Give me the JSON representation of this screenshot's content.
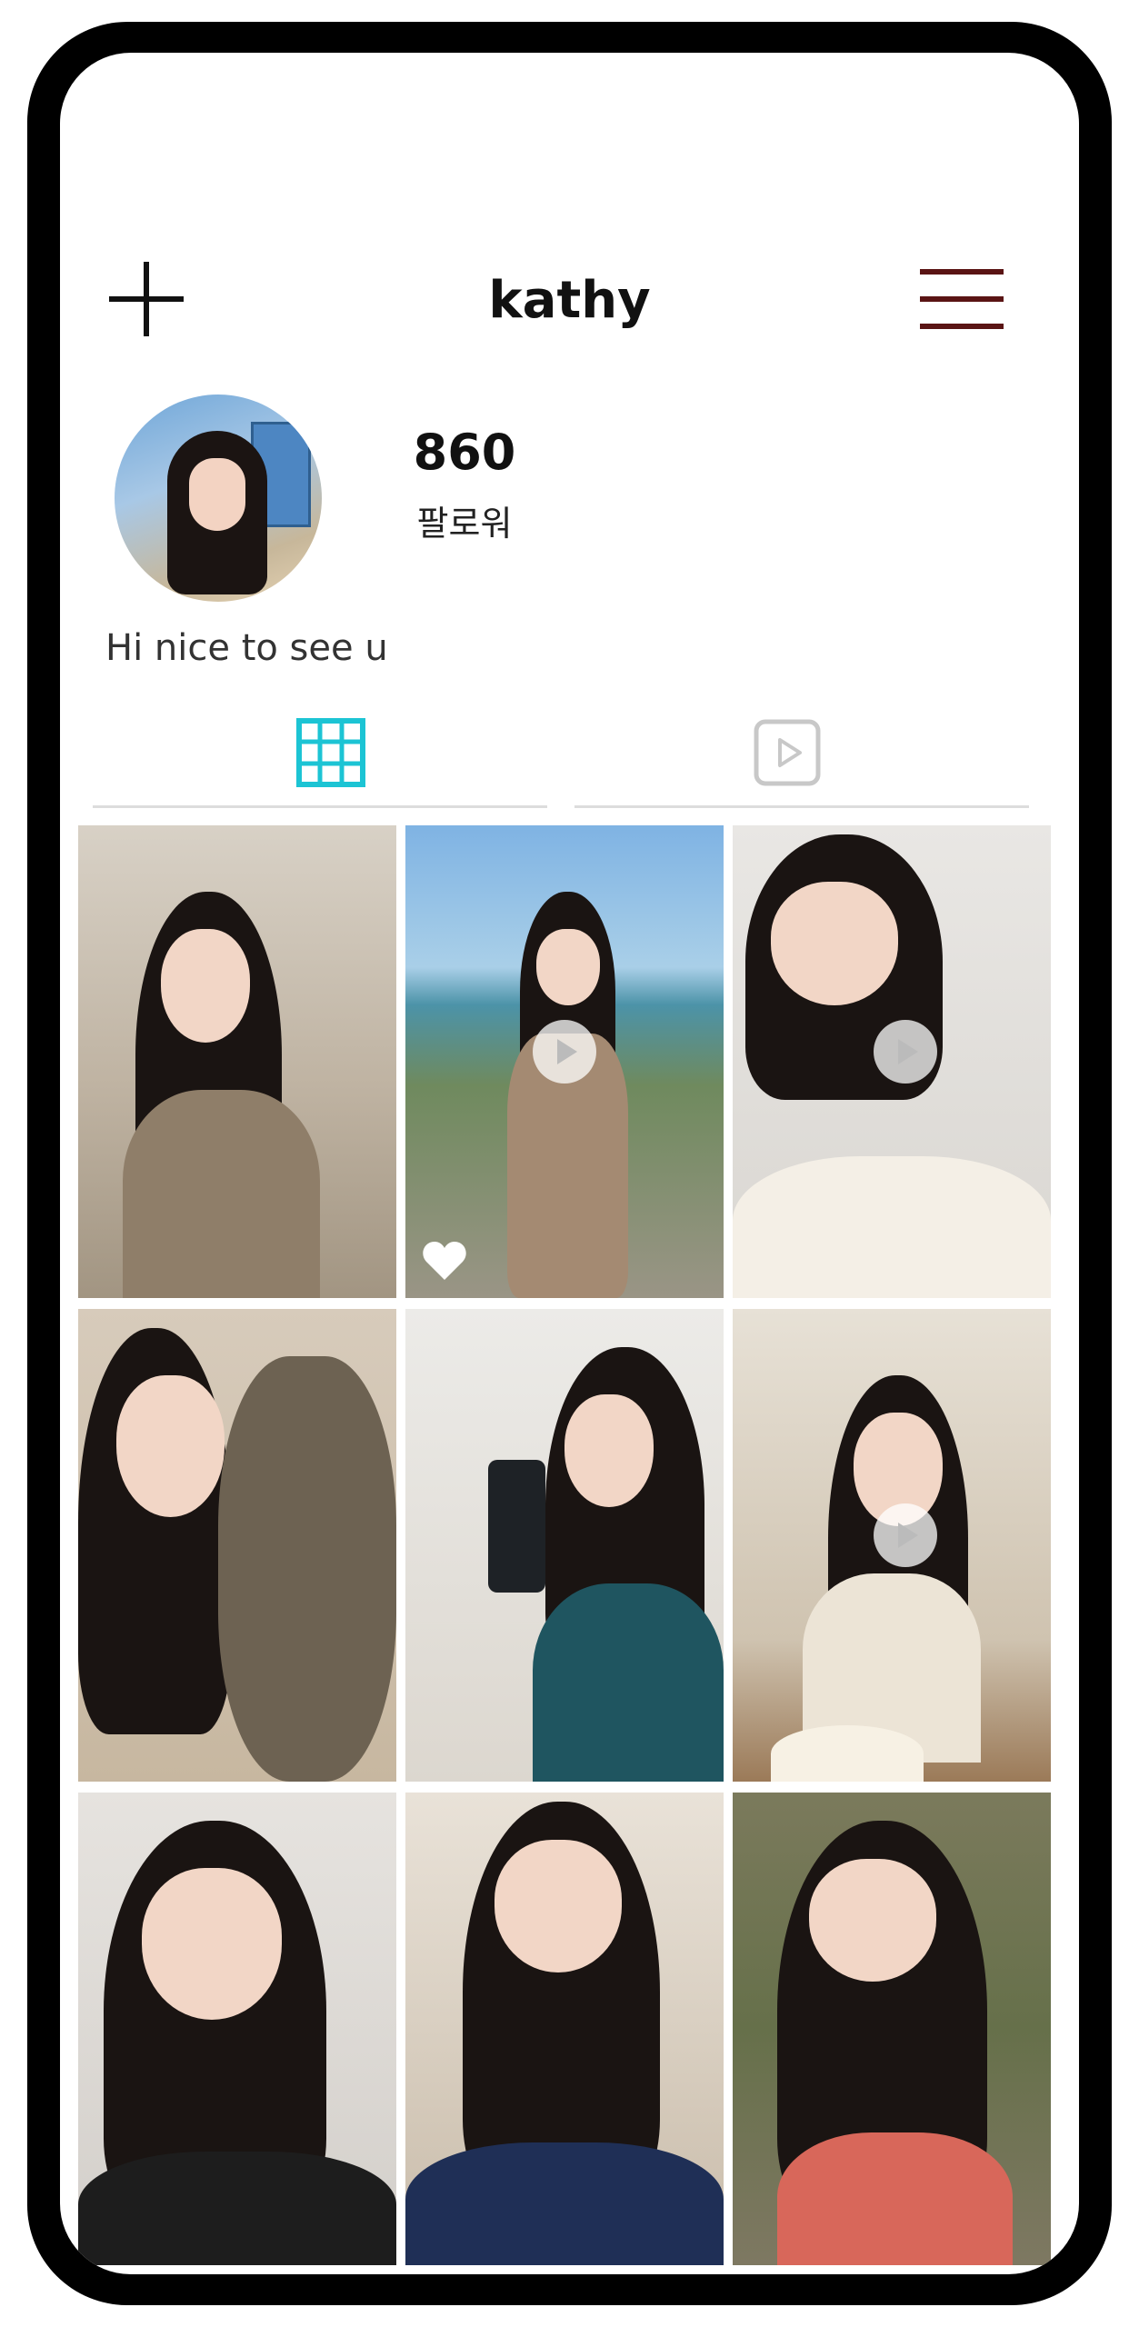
{
  "profile": {
    "username": "kathy",
    "followers_count": "860",
    "followers_label": "팔로워",
    "bio": "Hi nice to see u"
  },
  "icons": {
    "add": "plus-icon",
    "menu": "hamburger-menu-icon",
    "grid_tab": "grid-icon",
    "reels_tab": "play-square-icon"
  },
  "colors": {
    "active_tab": "#1cc4d4",
    "inactive_tab": "#bbbbbb",
    "menu_icon": "#5a1414"
  },
  "grid": {
    "columns": 3,
    "items": [
      {
        "type": "photo",
        "desc": "woman in beige knit sweater selfie in cafe"
      },
      {
        "type": "video",
        "desc": "woman in brown dress at seaside terrace",
        "liked": true
      },
      {
        "type": "video",
        "desc": "woman winking with hand near face"
      },
      {
        "type": "photo",
        "desc": "woman holding tabby cat"
      },
      {
        "type": "photo",
        "desc": "woman in teal top taking mirror selfie"
      },
      {
        "type": "video",
        "desc": "woman eating cake in cafe"
      },
      {
        "type": "photo",
        "desc": "woman in black top resting hand on cheek"
      },
      {
        "type": "photo",
        "desc": "woman in navy off-shoulder top"
      },
      {
        "type": "photo",
        "desc": "woman in coral top by stone wall"
      }
    ]
  }
}
